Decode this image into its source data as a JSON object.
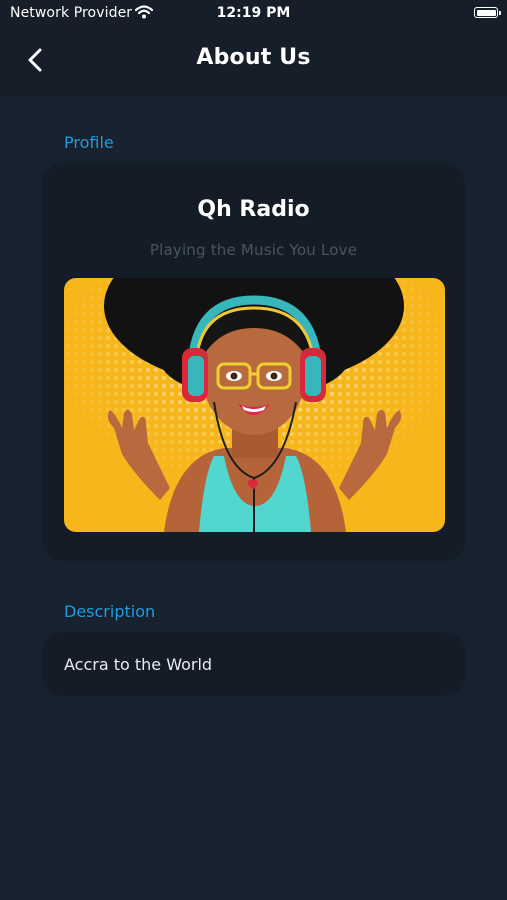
{
  "status_bar": {
    "carrier": "Network Provider",
    "time": "12:19 PM",
    "wifi_icon": "wifi-icon",
    "battery_icon": "battery-icon"
  },
  "header": {
    "title": "About Us",
    "back_icon": "chevron-left-icon"
  },
  "profile": {
    "section_label": "Profile",
    "name": "Qh Radio",
    "tagline": "Playing the Music You Love",
    "artwork_description_icon": "station-artwork"
  },
  "description": {
    "section_label": "Description",
    "text": "Accra to the World"
  },
  "colors": {
    "background": "#18222f",
    "header_background": "#151e29",
    "card_background": "#141c27",
    "accent": "#1f9be0",
    "artwork_yellow": "#f7b619"
  }
}
